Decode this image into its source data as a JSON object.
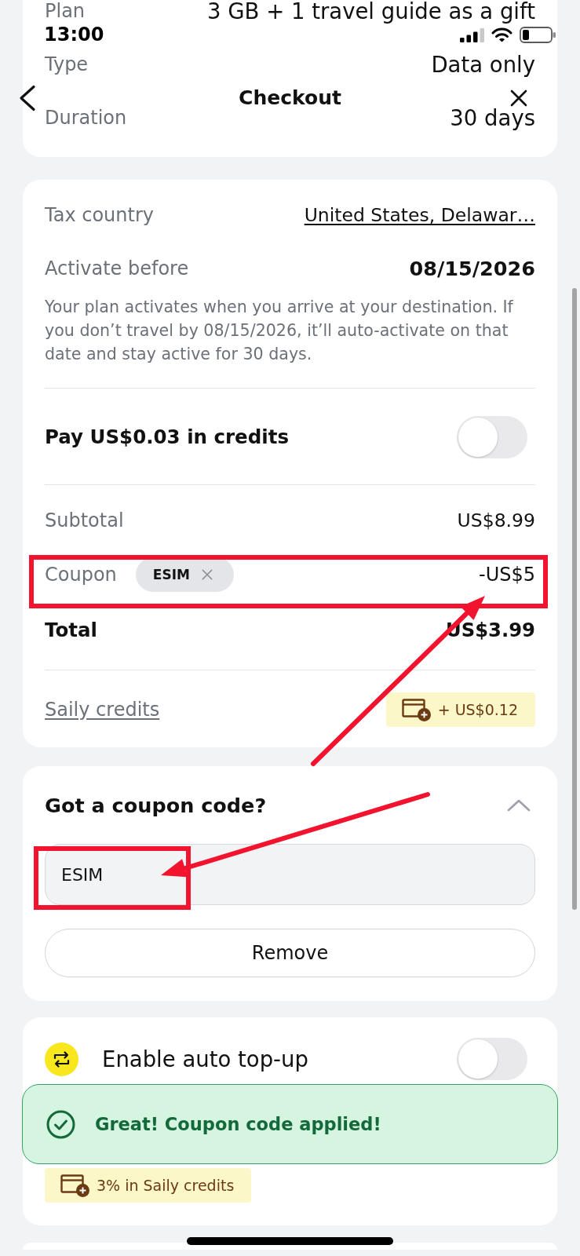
{
  "status_bar": {
    "time": "13:00"
  },
  "nav": {
    "title": "Checkout"
  },
  "plan_details": [
    {
      "label": "Plan",
      "value": "3 GB + 1 travel guide as a gift"
    },
    {
      "label": "Type",
      "value": "Data only"
    },
    {
      "label": "Duration",
      "value": "30 days"
    }
  ],
  "order": {
    "tax_country": {
      "label": "Tax country",
      "value": "United States, Delawar…"
    },
    "activate_before": {
      "label": "Activate before",
      "value": "08/15/2026"
    },
    "note": "Your plan activates when you arrive at your destination. If you don’t travel by 08/15/2026, it’ll auto-activate on that date and stay active for 30 days.",
    "pay_credits": {
      "label": "Pay US$0.03 in credits",
      "on": false
    },
    "subtotal": {
      "label": "Subtotal",
      "value": "US$8.99"
    },
    "coupon": {
      "label": "Coupon",
      "code": "ESIM",
      "amount": "-US$5"
    },
    "total": {
      "label": "Total",
      "value": "US$3.99"
    },
    "credits": {
      "label": "Saily credits",
      "reward": "+ US$0.12"
    }
  },
  "coupon_section": {
    "title": "Got a coupon code?",
    "expanded": true,
    "code_field": {
      "value": "ESIM"
    },
    "remove_button": "Remove"
  },
  "auto_topup": {
    "label": "Enable auto top-up",
    "on": false,
    "reward": "3% in Saily credits"
  },
  "toast": {
    "message": "Great! Coupon code applied!"
  }
}
